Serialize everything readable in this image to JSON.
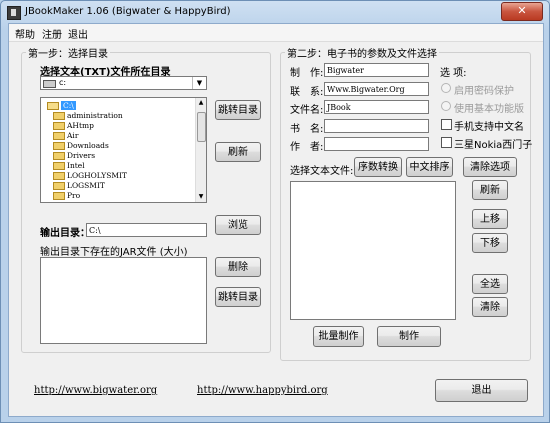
{
  "window": {
    "title": "JBookMaker 1.06 (Bigwater & HappyBird)",
    "close_glyph": "✕"
  },
  "menu": [
    "帮助",
    "注册",
    "退出"
  ],
  "step1": {
    "legend": "第一步：选择目录",
    "dir_label": "选择文本(TXT)文件所在目录",
    "drive_value": "c:",
    "dirs": [
      {
        "name": "C:\\",
        "selected": true,
        "open": true
      },
      {
        "name": "administration",
        "selected": false,
        "open": false
      },
      {
        "name": "AHtmp",
        "selected": false,
        "open": false
      },
      {
        "name": "Air",
        "selected": false,
        "open": false
      },
      {
        "name": "Downloads",
        "selected": false,
        "open": false
      },
      {
        "name": "Drivers",
        "selected": false,
        "open": false
      },
      {
        "name": "Intel",
        "selected": false,
        "open": false
      },
      {
        "name": "LOGHOLYSMIT",
        "selected": false,
        "open": false
      },
      {
        "name": "LOGSMIT",
        "selected": false,
        "open": false
      },
      {
        "name": "Pro",
        "selected": false,
        "open": false
      }
    ],
    "jump_dir_button": "跳转目录",
    "refresh_button": "刷新",
    "output_label": "输出目录：",
    "output_value": "C:\\",
    "browse_button": "浏览",
    "jar_list_label": "输出目录下存在的JAR文件 (大小)",
    "delete_button": "删除",
    "jump_dir_button2": "跳转目录"
  },
  "step2": {
    "legend": "第二步：电子书的参数及文件选择",
    "fields": [
      {
        "label": "制　作:",
        "value": "Bigwater"
      },
      {
        "label": "联　系:",
        "value": "Www.Bigwater.Org"
      },
      {
        "label": "文件名:",
        "value": "JBook"
      },
      {
        "label": "书　名:",
        "value": ""
      },
      {
        "label": "作　者:",
        "value": ""
      }
    ],
    "options_label": "选 项:",
    "radio_password": "启用密码保护",
    "radio_basic": "使用基本功能版",
    "check_chinese": "手机支持中文名",
    "check_nokia": "三星Nokia西门子",
    "select_text_label": "选择文本文件:",
    "sequence_button": "序数转换",
    "chinese_sort_button": "中文排序",
    "clear_button": "清除选项",
    "refresh_button": "刷新",
    "up_button": "上移",
    "down_button": "下移",
    "select_all_button": "全选",
    "remove_button": "清除",
    "batch_button": "批量制作",
    "make_button": "制作"
  },
  "footer": {
    "link1": "http://www.bigwater.org",
    "link2": "http://www.happybird.org",
    "exit_button": "退出"
  }
}
